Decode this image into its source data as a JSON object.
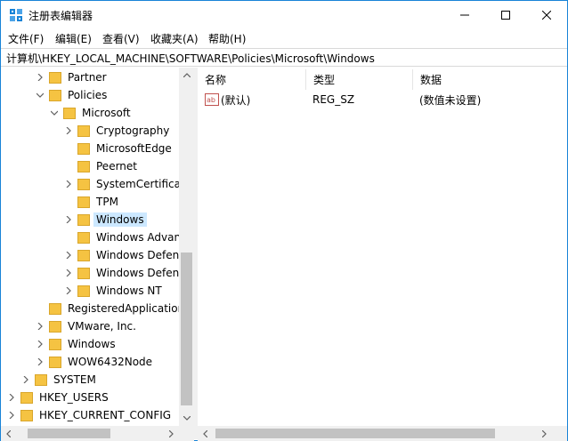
{
  "window": {
    "title": "注册表编辑器",
    "controls": {
      "minimize": "minimize",
      "maximize": "maximize",
      "close": "close"
    }
  },
  "menu": [
    "文件(F)",
    "编辑(E)",
    "查看(V)",
    "收藏夹(A)",
    "帮助(H)"
  ],
  "address": "计算机\\HKEY_LOCAL_MACHINE\\SOFTWARE\\Policies\\Microsoft\\Windows",
  "tree": [
    {
      "label": "Partner",
      "chevron": "right"
    },
    {
      "label": "Policies",
      "chevron": "down"
    },
    {
      "label": "Microsoft",
      "chevron": "down"
    },
    {
      "label": "Cryptography",
      "chevron": "right"
    },
    {
      "label": "MicrosoftEdge",
      "chevron": "none"
    },
    {
      "label": "Peernet",
      "chevron": "none"
    },
    {
      "label": "SystemCertificate",
      "chevron": "right"
    },
    {
      "label": "TPM",
      "chevron": "none"
    },
    {
      "label": "Windows",
      "chevron": "right",
      "selected": true
    },
    {
      "label": "Windows Advan",
      "chevron": "none"
    },
    {
      "label": "Windows Defenc",
      "chevron": "right"
    },
    {
      "label": "Windows Defenc",
      "chevron": "right"
    },
    {
      "label": "Windows NT",
      "chevron": "right"
    },
    {
      "label": "RegisteredApplication",
      "chevron": "none"
    },
    {
      "label": "VMware, Inc.",
      "chevron": "right"
    },
    {
      "label": "Windows",
      "chevron": "right"
    },
    {
      "label": "WOW6432Node",
      "chevron": "right"
    },
    {
      "label": "SYSTEM",
      "chevron": "right"
    },
    {
      "label": "HKEY_USERS",
      "chevron": "right"
    },
    {
      "label": "HKEY_CURRENT_CONFIG",
      "chevron": "right"
    }
  ],
  "list": {
    "columns": [
      "名称",
      "类型",
      "数据"
    ],
    "rows": [
      {
        "name": "(默认)",
        "type": "REG_SZ",
        "data": "(数值未设置)",
        "icon": "string-value-icon"
      }
    ]
  },
  "colors": {
    "accent": "#1883d7",
    "folder": "#f5c342",
    "selection": "#cce8ff"
  }
}
